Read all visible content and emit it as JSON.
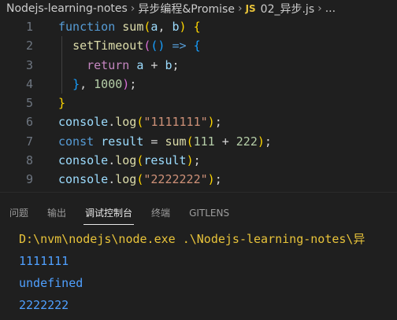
{
  "breadcrumb": {
    "folder1": "Nodejs-learning-notes",
    "folder2": "异步编程&Promise",
    "file_icon": "JS",
    "file": "02_异步.js",
    "more": "..."
  },
  "editor": {
    "line_numbers": [
      "1",
      "2",
      "3",
      "4",
      "5",
      "6",
      "7",
      "8",
      "9"
    ],
    "lines": [
      [
        {
          "t": "function",
          "c": "kw"
        },
        {
          "t": " ",
          "c": ""
        },
        {
          "t": "sum",
          "c": "fn"
        },
        {
          "t": "(",
          "c": "p1"
        },
        {
          "t": "a",
          "c": "var"
        },
        {
          "t": ", ",
          "c": ""
        },
        {
          "t": "b",
          "c": "var"
        },
        {
          "t": ")",
          "c": "p1"
        },
        {
          "t": " ",
          "c": ""
        },
        {
          "t": "{",
          "c": "p1"
        }
      ],
      [
        {
          "t": "  ",
          "c": ""
        },
        {
          "t": "setTimeout",
          "c": "fn"
        },
        {
          "t": "(",
          "c": "p2"
        },
        {
          "t": "()",
          "c": "p3"
        },
        {
          "t": " ",
          "c": ""
        },
        {
          "t": "=>",
          "c": "kw"
        },
        {
          "t": " ",
          "c": ""
        },
        {
          "t": "{",
          "c": "p3"
        }
      ],
      [
        {
          "t": "    ",
          "c": ""
        },
        {
          "t": "return",
          "c": "ctrl"
        },
        {
          "t": " ",
          "c": ""
        },
        {
          "t": "a",
          "c": "var"
        },
        {
          "t": " + ",
          "c": ""
        },
        {
          "t": "b",
          "c": "var"
        },
        {
          "t": ";",
          "c": ""
        }
      ],
      [
        {
          "t": "  ",
          "c": ""
        },
        {
          "t": "}",
          "c": "p3"
        },
        {
          "t": ", ",
          "c": ""
        },
        {
          "t": "1000",
          "c": "num"
        },
        {
          "t": ")",
          "c": "p2"
        },
        {
          "t": ";",
          "c": ""
        }
      ],
      [
        {
          "t": "}",
          "c": "p1"
        }
      ],
      [
        {
          "t": "console",
          "c": "var"
        },
        {
          "t": ".",
          "c": ""
        },
        {
          "t": "log",
          "c": "fn"
        },
        {
          "t": "(",
          "c": "p1"
        },
        {
          "t": "\"1111111\"",
          "c": "str"
        },
        {
          "t": ")",
          "c": "p1"
        },
        {
          "t": ";",
          "c": ""
        }
      ],
      [
        {
          "t": "const",
          "c": "kw"
        },
        {
          "t": " ",
          "c": ""
        },
        {
          "t": "result",
          "c": "var"
        },
        {
          "t": " = ",
          "c": ""
        },
        {
          "t": "sum",
          "c": "fn"
        },
        {
          "t": "(",
          "c": "p1"
        },
        {
          "t": "111",
          "c": "num"
        },
        {
          "t": " + ",
          "c": ""
        },
        {
          "t": "222",
          "c": "num"
        },
        {
          "t": ")",
          "c": "p1"
        },
        {
          "t": ";",
          "c": ""
        }
      ],
      [
        {
          "t": "console",
          "c": "var"
        },
        {
          "t": ".",
          "c": ""
        },
        {
          "t": "log",
          "c": "fn"
        },
        {
          "t": "(",
          "c": "p1"
        },
        {
          "t": "result",
          "c": "var"
        },
        {
          "t": ")",
          "c": "p1"
        },
        {
          "t": ";",
          "c": ""
        }
      ],
      [
        {
          "t": "console",
          "c": "var"
        },
        {
          "t": ".",
          "c": ""
        },
        {
          "t": "log",
          "c": "fn"
        },
        {
          "t": "(",
          "c": "p1"
        },
        {
          "t": "\"2222222\"",
          "c": "str"
        },
        {
          "t": ")",
          "c": "p1"
        },
        {
          "t": ";",
          "c": ""
        }
      ]
    ]
  },
  "panel": {
    "tabs": [
      "问题",
      "输出",
      "调试控制台",
      "终端",
      "GITLENS"
    ],
    "active_tab": "调试控制台"
  },
  "output": {
    "command": "D:\\nvm\\nodejs\\node.exe .\\Nodejs-learning-notes\\异",
    "lines": [
      "1111111",
      "undefined",
      "2222222"
    ]
  }
}
